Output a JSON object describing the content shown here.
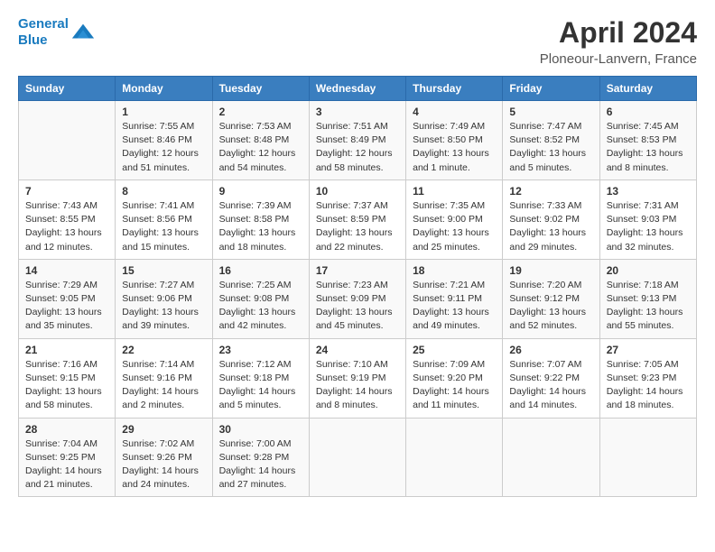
{
  "header": {
    "logo_line1": "General",
    "logo_line2": "Blue",
    "title": "April 2024",
    "subtitle": "Ploneour-Lanvern, France"
  },
  "columns": [
    "Sunday",
    "Monday",
    "Tuesday",
    "Wednesday",
    "Thursday",
    "Friday",
    "Saturday"
  ],
  "weeks": [
    [
      {
        "day": "",
        "sunrise": "",
        "sunset": "",
        "daylight": ""
      },
      {
        "day": "1",
        "sunrise": "Sunrise: 7:55 AM",
        "sunset": "Sunset: 8:46 PM",
        "daylight": "Daylight: 12 hours and 51 minutes."
      },
      {
        "day": "2",
        "sunrise": "Sunrise: 7:53 AM",
        "sunset": "Sunset: 8:48 PM",
        "daylight": "Daylight: 12 hours and 54 minutes."
      },
      {
        "day": "3",
        "sunrise": "Sunrise: 7:51 AM",
        "sunset": "Sunset: 8:49 PM",
        "daylight": "Daylight: 12 hours and 58 minutes."
      },
      {
        "day": "4",
        "sunrise": "Sunrise: 7:49 AM",
        "sunset": "Sunset: 8:50 PM",
        "daylight": "Daylight: 13 hours and 1 minute."
      },
      {
        "day": "5",
        "sunrise": "Sunrise: 7:47 AM",
        "sunset": "Sunset: 8:52 PM",
        "daylight": "Daylight: 13 hours and 5 minutes."
      },
      {
        "day": "6",
        "sunrise": "Sunrise: 7:45 AM",
        "sunset": "Sunset: 8:53 PM",
        "daylight": "Daylight: 13 hours and 8 minutes."
      }
    ],
    [
      {
        "day": "7",
        "sunrise": "Sunrise: 7:43 AM",
        "sunset": "Sunset: 8:55 PM",
        "daylight": "Daylight: 13 hours and 12 minutes."
      },
      {
        "day": "8",
        "sunrise": "Sunrise: 7:41 AM",
        "sunset": "Sunset: 8:56 PM",
        "daylight": "Daylight: 13 hours and 15 minutes."
      },
      {
        "day": "9",
        "sunrise": "Sunrise: 7:39 AM",
        "sunset": "Sunset: 8:58 PM",
        "daylight": "Daylight: 13 hours and 18 minutes."
      },
      {
        "day": "10",
        "sunrise": "Sunrise: 7:37 AM",
        "sunset": "Sunset: 8:59 PM",
        "daylight": "Daylight: 13 hours and 22 minutes."
      },
      {
        "day": "11",
        "sunrise": "Sunrise: 7:35 AM",
        "sunset": "Sunset: 9:00 PM",
        "daylight": "Daylight: 13 hours and 25 minutes."
      },
      {
        "day": "12",
        "sunrise": "Sunrise: 7:33 AM",
        "sunset": "Sunset: 9:02 PM",
        "daylight": "Daylight: 13 hours and 29 minutes."
      },
      {
        "day": "13",
        "sunrise": "Sunrise: 7:31 AM",
        "sunset": "Sunset: 9:03 PM",
        "daylight": "Daylight: 13 hours and 32 minutes."
      }
    ],
    [
      {
        "day": "14",
        "sunrise": "Sunrise: 7:29 AM",
        "sunset": "Sunset: 9:05 PM",
        "daylight": "Daylight: 13 hours and 35 minutes."
      },
      {
        "day": "15",
        "sunrise": "Sunrise: 7:27 AM",
        "sunset": "Sunset: 9:06 PM",
        "daylight": "Daylight: 13 hours and 39 minutes."
      },
      {
        "day": "16",
        "sunrise": "Sunrise: 7:25 AM",
        "sunset": "Sunset: 9:08 PM",
        "daylight": "Daylight: 13 hours and 42 minutes."
      },
      {
        "day": "17",
        "sunrise": "Sunrise: 7:23 AM",
        "sunset": "Sunset: 9:09 PM",
        "daylight": "Daylight: 13 hours and 45 minutes."
      },
      {
        "day": "18",
        "sunrise": "Sunrise: 7:21 AM",
        "sunset": "Sunset: 9:11 PM",
        "daylight": "Daylight: 13 hours and 49 minutes."
      },
      {
        "day": "19",
        "sunrise": "Sunrise: 7:20 AM",
        "sunset": "Sunset: 9:12 PM",
        "daylight": "Daylight: 13 hours and 52 minutes."
      },
      {
        "day": "20",
        "sunrise": "Sunrise: 7:18 AM",
        "sunset": "Sunset: 9:13 PM",
        "daylight": "Daylight: 13 hours and 55 minutes."
      }
    ],
    [
      {
        "day": "21",
        "sunrise": "Sunrise: 7:16 AM",
        "sunset": "Sunset: 9:15 PM",
        "daylight": "Daylight: 13 hours and 58 minutes."
      },
      {
        "day": "22",
        "sunrise": "Sunrise: 7:14 AM",
        "sunset": "Sunset: 9:16 PM",
        "daylight": "Daylight: 14 hours and 2 minutes."
      },
      {
        "day": "23",
        "sunrise": "Sunrise: 7:12 AM",
        "sunset": "Sunset: 9:18 PM",
        "daylight": "Daylight: 14 hours and 5 minutes."
      },
      {
        "day": "24",
        "sunrise": "Sunrise: 7:10 AM",
        "sunset": "Sunset: 9:19 PM",
        "daylight": "Daylight: 14 hours and 8 minutes."
      },
      {
        "day": "25",
        "sunrise": "Sunrise: 7:09 AM",
        "sunset": "Sunset: 9:20 PM",
        "daylight": "Daylight: 14 hours and 11 minutes."
      },
      {
        "day": "26",
        "sunrise": "Sunrise: 7:07 AM",
        "sunset": "Sunset: 9:22 PM",
        "daylight": "Daylight: 14 hours and 14 minutes."
      },
      {
        "day": "27",
        "sunrise": "Sunrise: 7:05 AM",
        "sunset": "Sunset: 9:23 PM",
        "daylight": "Daylight: 14 hours and 18 minutes."
      }
    ],
    [
      {
        "day": "28",
        "sunrise": "Sunrise: 7:04 AM",
        "sunset": "Sunset: 9:25 PM",
        "daylight": "Daylight: 14 hours and 21 minutes."
      },
      {
        "day": "29",
        "sunrise": "Sunrise: 7:02 AM",
        "sunset": "Sunset: 9:26 PM",
        "daylight": "Daylight: 14 hours and 24 minutes."
      },
      {
        "day": "30",
        "sunrise": "Sunrise: 7:00 AM",
        "sunset": "Sunset: 9:28 PM",
        "daylight": "Daylight: 14 hours and 27 minutes."
      },
      {
        "day": "",
        "sunrise": "",
        "sunset": "",
        "daylight": ""
      },
      {
        "day": "",
        "sunrise": "",
        "sunset": "",
        "daylight": ""
      },
      {
        "day": "",
        "sunrise": "",
        "sunset": "",
        "daylight": ""
      },
      {
        "day": "",
        "sunrise": "",
        "sunset": "",
        "daylight": ""
      }
    ]
  ]
}
